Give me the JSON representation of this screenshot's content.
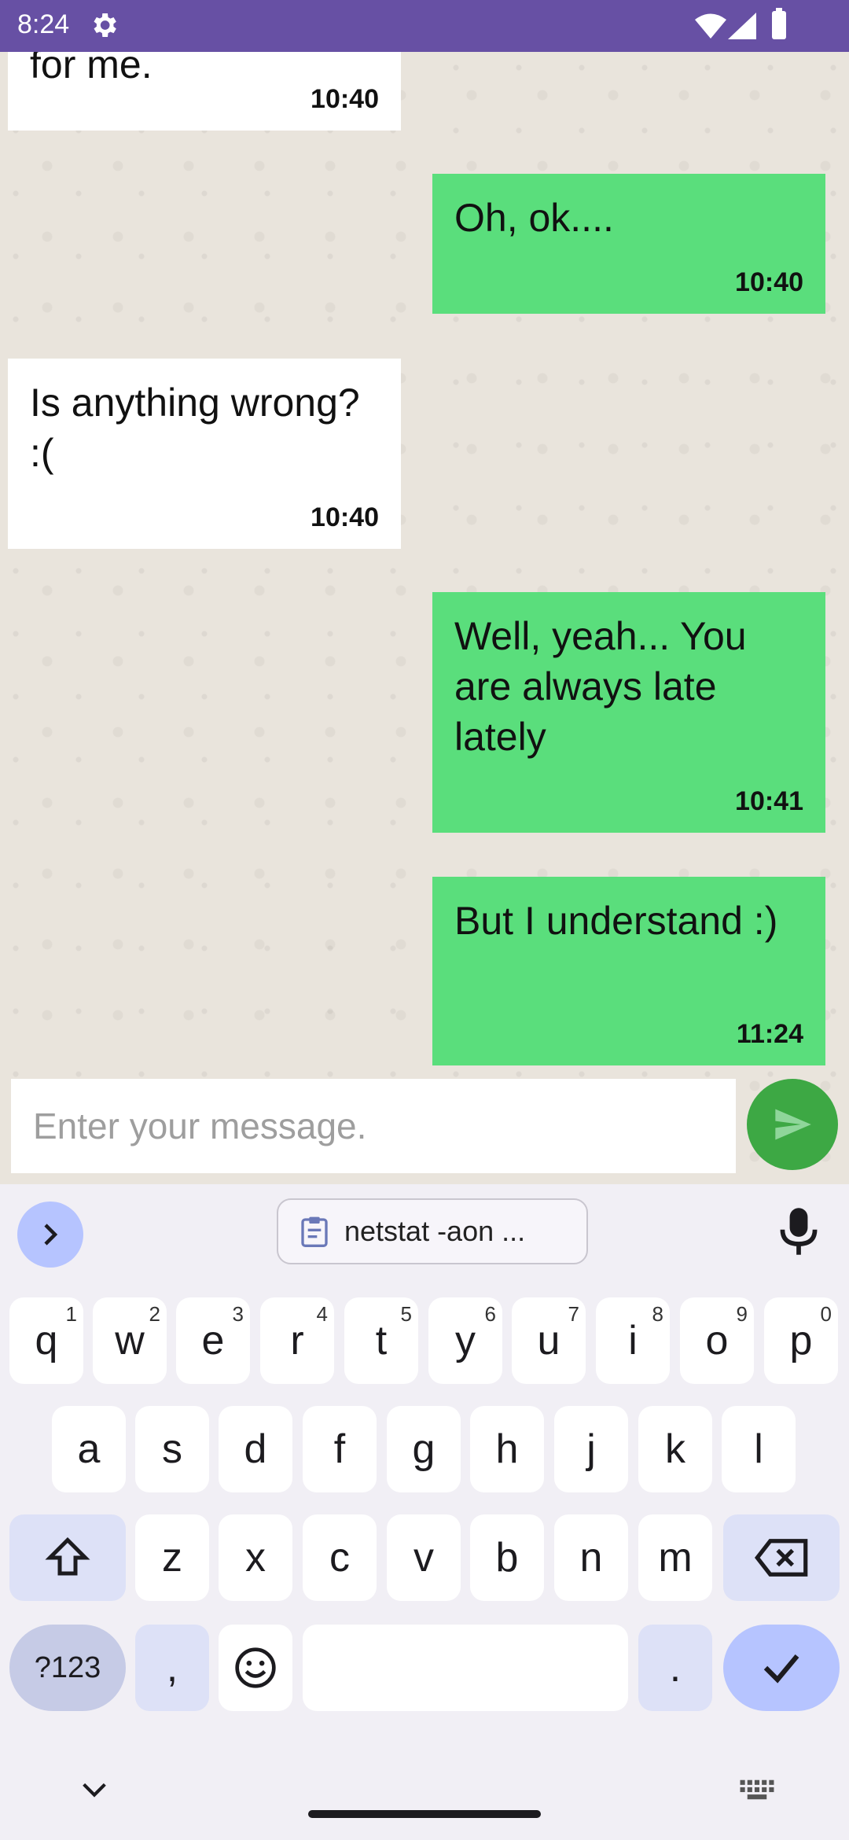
{
  "status_bar": {
    "time": "8:24"
  },
  "messages": [
    {
      "direction": "incoming",
      "text": "for me.",
      "time": "10:40"
    },
    {
      "direction": "outgoing",
      "text": "Oh, ok....",
      "time": "10:40"
    },
    {
      "direction": "incoming",
      "text": "Is anything wrong? :(",
      "time": "10:40"
    },
    {
      "direction": "outgoing",
      "text": "Well, yeah... You are always late lately",
      "time": "10:41"
    },
    {
      "direction": "outgoing",
      "text": "But I understand :)",
      "time": "11:24"
    }
  ],
  "composer": {
    "placeholder": "Enter your message.",
    "value": ""
  },
  "keyboard": {
    "clipboard_chip": "netstat -aon ...",
    "row1": [
      {
        "key": "q",
        "hint": "1"
      },
      {
        "key": "w",
        "hint": "2"
      },
      {
        "key": "e",
        "hint": "3"
      },
      {
        "key": "r",
        "hint": "4"
      },
      {
        "key": "t",
        "hint": "5"
      },
      {
        "key": "y",
        "hint": "6"
      },
      {
        "key": "u",
        "hint": "7"
      },
      {
        "key": "i",
        "hint": "8"
      },
      {
        "key": "o",
        "hint": "9"
      },
      {
        "key": "p",
        "hint": "0"
      }
    ],
    "row2": [
      "a",
      "s",
      "d",
      "f",
      "g",
      "h",
      "j",
      "k",
      "l"
    ],
    "row3": [
      "z",
      "x",
      "c",
      "v",
      "b",
      "n",
      "m"
    ],
    "symbols_label": "?123",
    "comma": ",",
    "period": "."
  },
  "colors": {
    "status_bar": "#6750a4",
    "outgoing_bubble": "#5ade7c",
    "incoming_bubble": "#ffffff",
    "send_button": "#3da844"
  }
}
